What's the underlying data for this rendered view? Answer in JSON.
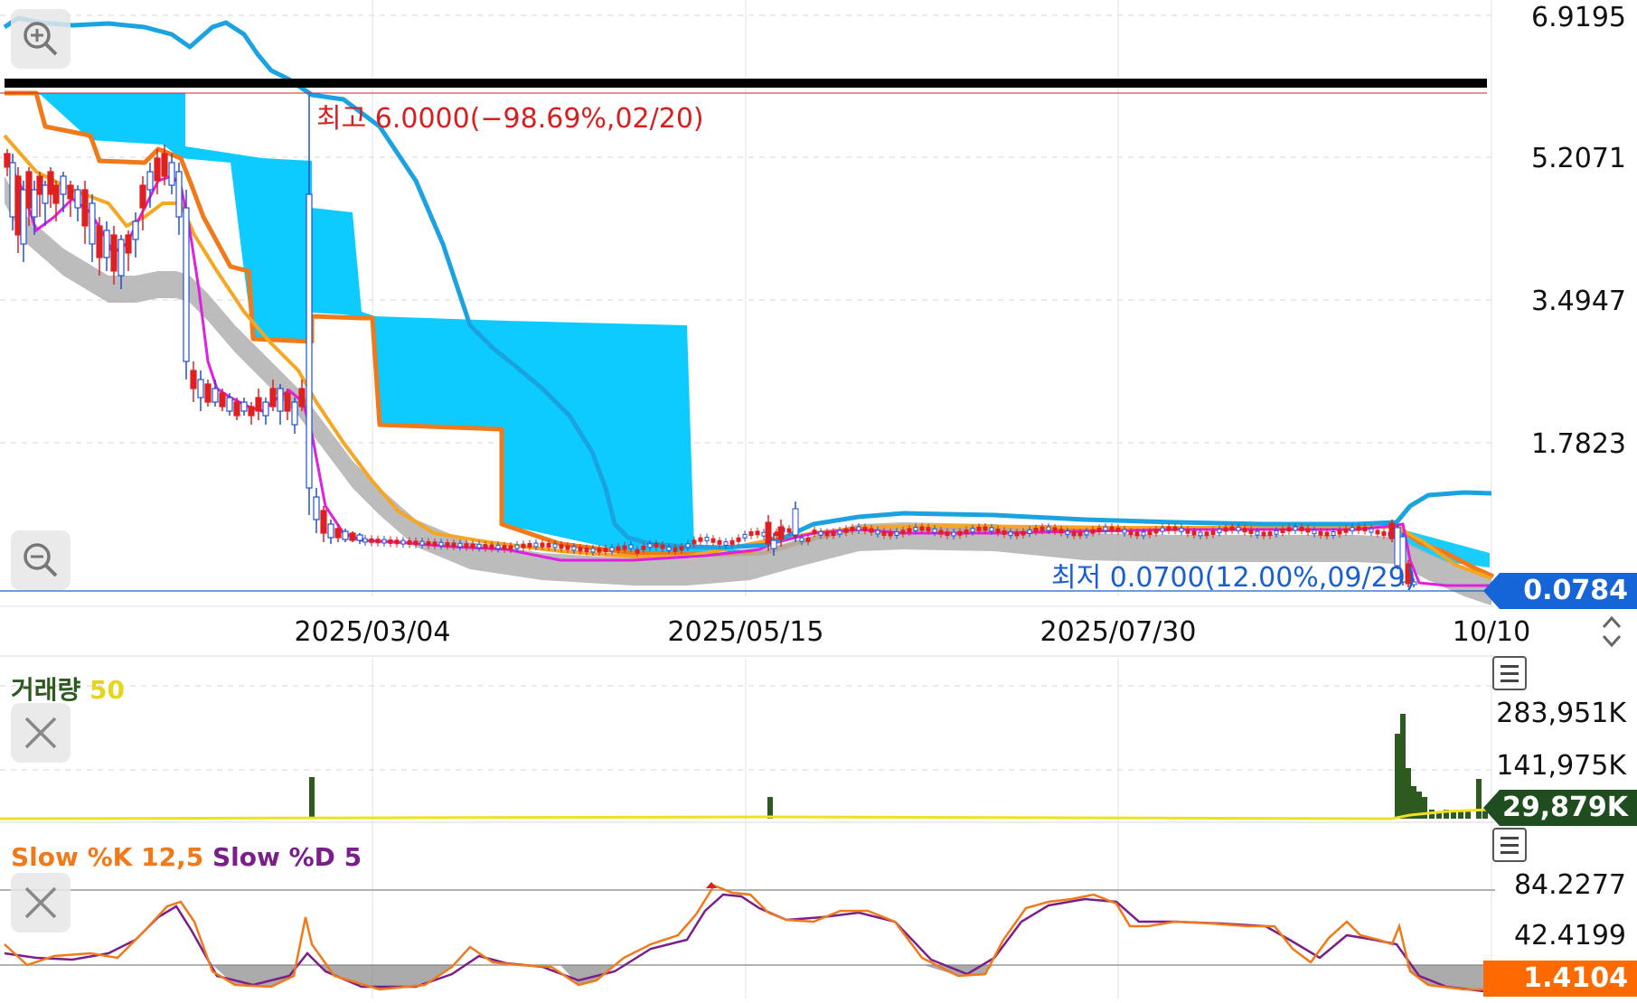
{
  "price_axis": [
    "6.9195",
    "5.2071",
    "3.4947",
    "1.7823"
  ],
  "last_price": "0.0784",
  "high_label": "최고 6.0000(−98.69%,02/20)",
  "low_label": "최저 0.0700(12.00%,09/29)",
  "date_axis": [
    "2025/03/04",
    "2025/05/15",
    "2025/07/30",
    "10/10"
  ],
  "volume": {
    "title": "거래량",
    "period": "50",
    "axis": [
      "283,951K",
      "141,975K"
    ],
    "last": "29,879K"
  },
  "stochastic": {
    "k_label": "Slow %K 12,5",
    "d_label": "Slow %D 5",
    "axis": [
      "84.2277",
      "42.4199"
    ],
    "last": "1.4104"
  },
  "colors": {
    "candle_up": "#e02020",
    "candle_down": "#2050d0",
    "cloud": "#00c8ff",
    "lagging_span": "#1aa3e0",
    "leading_span": "#f07a1a",
    "short_ma": "#e020e0",
    "mid_ma": "#f5a623",
    "long_band": "#b0b0b0",
    "volume_bar": "#2d5a1e",
    "volume_ma": "#f0e020",
    "stoch_k": "#f07a1a",
    "stoch_d": "#7a1f8a",
    "high_line": "#000000"
  },
  "icons": [
    "zoom-in-icon",
    "zoom-out-icon",
    "close-volume-icon",
    "close-stochastic-icon",
    "menu-icon",
    "scroll-arrows-icon"
  ],
  "chart_data": [
    {
      "type": "line",
      "title": "",
      "xlabel": "",
      "ylabel": "",
      "x_ticks": [
        "2025/03/04",
        "2025/05/15",
        "2025/07/30",
        "10/10"
      ],
      "y_ticks": [
        6.9195,
        5.2071,
        3.4947,
        1.7823
      ],
      "ylim": [
        0.0,
        6.92
      ],
      "high": 6.0,
      "low": 0.07,
      "last": 0.0784,
      "grid": true,
      "series": []
    },
    {
      "type": "bar",
      "title": "거래량 50",
      "y_ticks": [
        283951,
        141975
      ],
      "last": 29879,
      "series": []
    },
    {
      "type": "line",
      "title": "Slow %K 12,5 Slow %D 5",
      "y_ticks": [
        84.2277,
        42.4199
      ],
      "last": 1.4104,
      "series": [
        {
          "name": "Slow %K 12,5"
        },
        {
          "name": "Slow %D 5"
        }
      ]
    }
  ]
}
